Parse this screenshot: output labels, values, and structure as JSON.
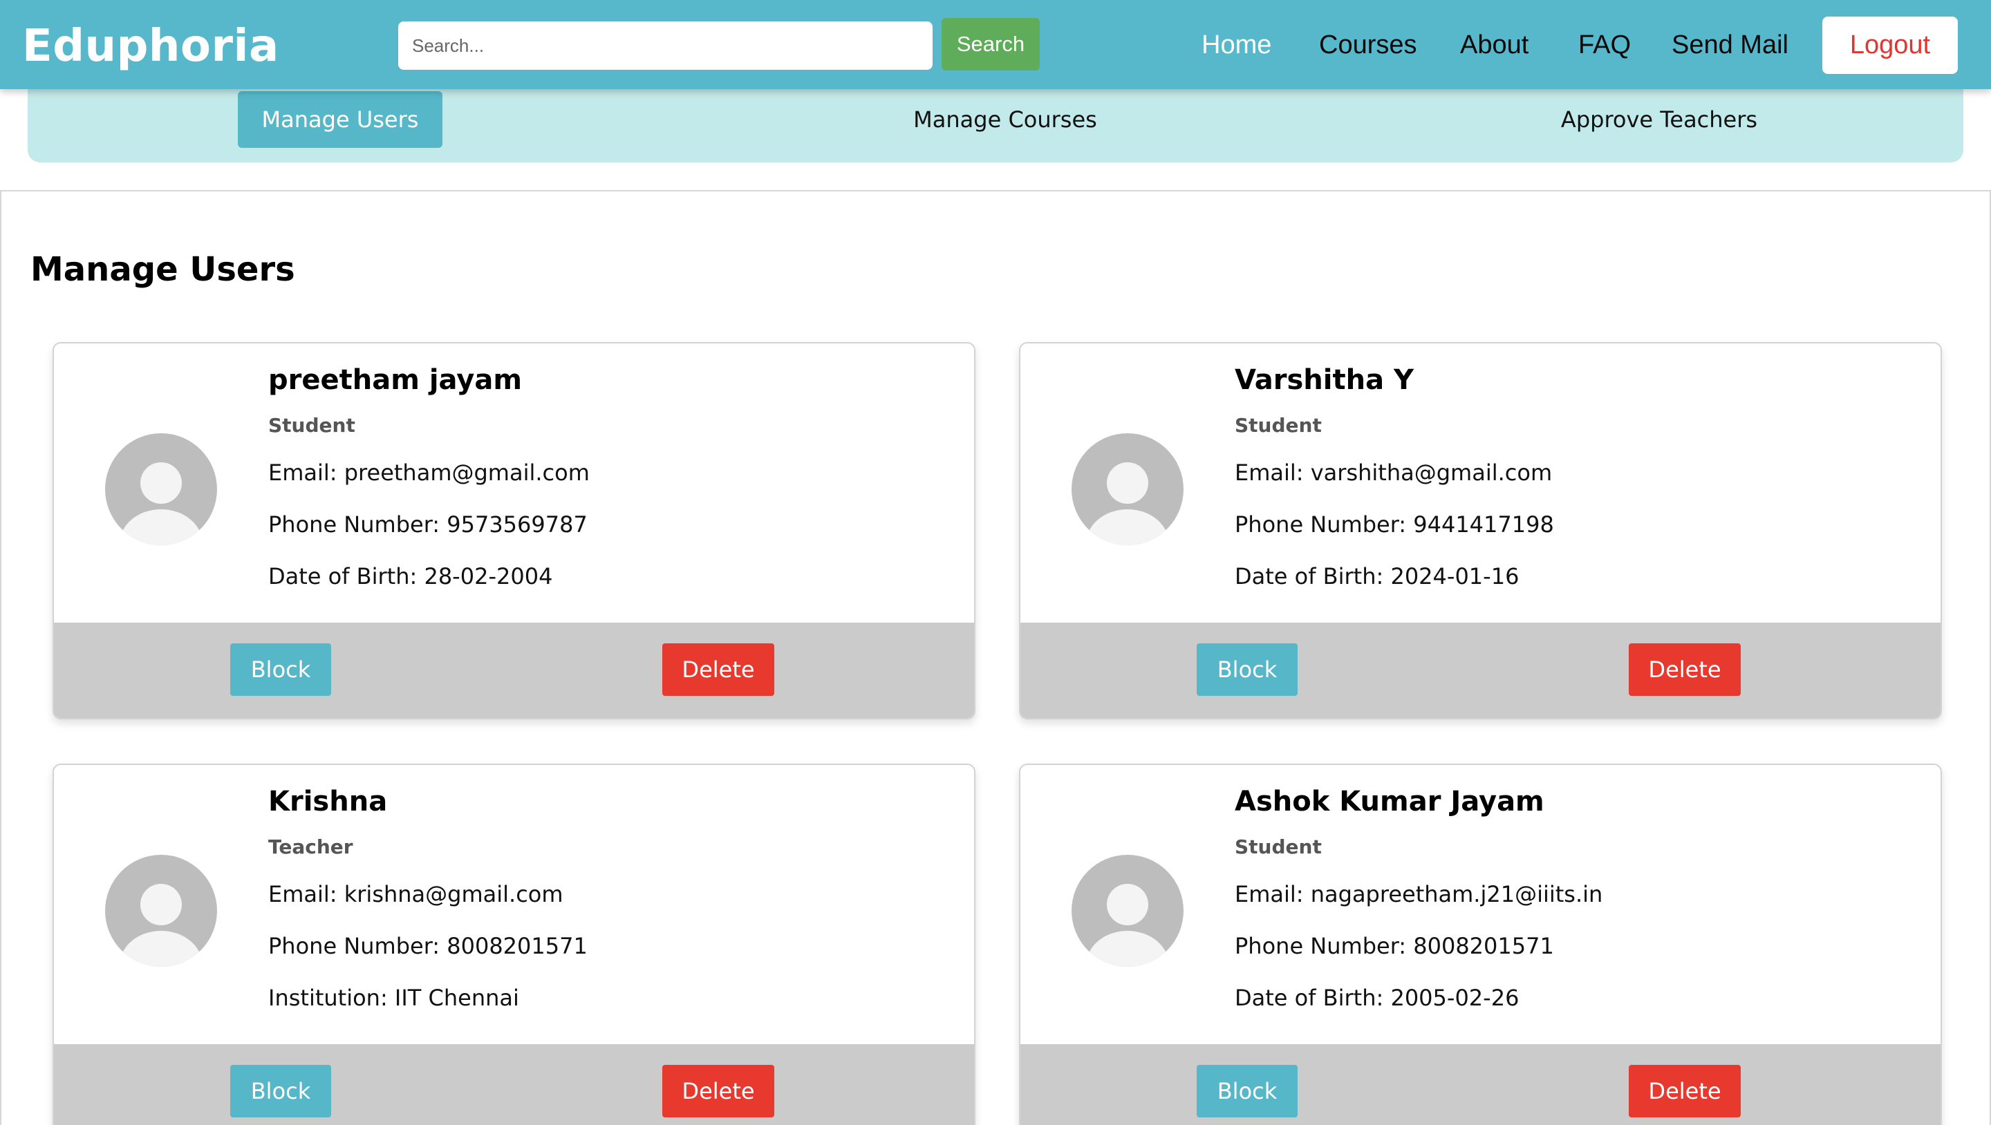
{
  "navbar": {
    "brand": "Eduphoria",
    "search_placeholder": "Search...",
    "search_label": "Search",
    "links": [
      "Home",
      "Courses",
      "About",
      "FAQ",
      "Send Mail"
    ],
    "logout_label": "Logout"
  },
  "subnav": {
    "tabs": [
      "Manage Users",
      "Manage Courses",
      "Approve Teachers"
    ]
  },
  "main": {
    "title": "Manage Users",
    "block_label": "Block",
    "delete_label": "Delete",
    "users": [
      {
        "name": "preetham jayam",
        "role": "Student",
        "email": "Email: preetham@gmail.com",
        "phone": "Phone Number: 9573569787",
        "extra": "Date of Birth: 28-02-2004"
      },
      {
        "name": "Varshitha Y",
        "role": "Student",
        "email": "Email: varshitha@gmail.com",
        "phone": "Phone Number: 9441417198",
        "extra": "Date of Birth: 2024-01-16"
      },
      {
        "name": "Krishna",
        "role": "Teacher",
        "email": "Email: krishna@gmail.com",
        "phone": "Phone Number: 8008201571",
        "extra": "Institution: IIT Chennai"
      },
      {
        "name": "Ashok Kumar Jayam",
        "role": "Student",
        "email": "Email: nagapreetham.j21@iiits.in",
        "phone": "Phone Number: 8008201571",
        "extra": "Date of Birth: 2005-02-26"
      }
    ]
  },
  "colors": {
    "navbar": "#57b8cb",
    "subnav": "#c3eaea",
    "search_button": "#5fac5a",
    "block_button": "#55b7c8",
    "delete_button": "#e8392f",
    "logout_text": "#e3342f"
  }
}
